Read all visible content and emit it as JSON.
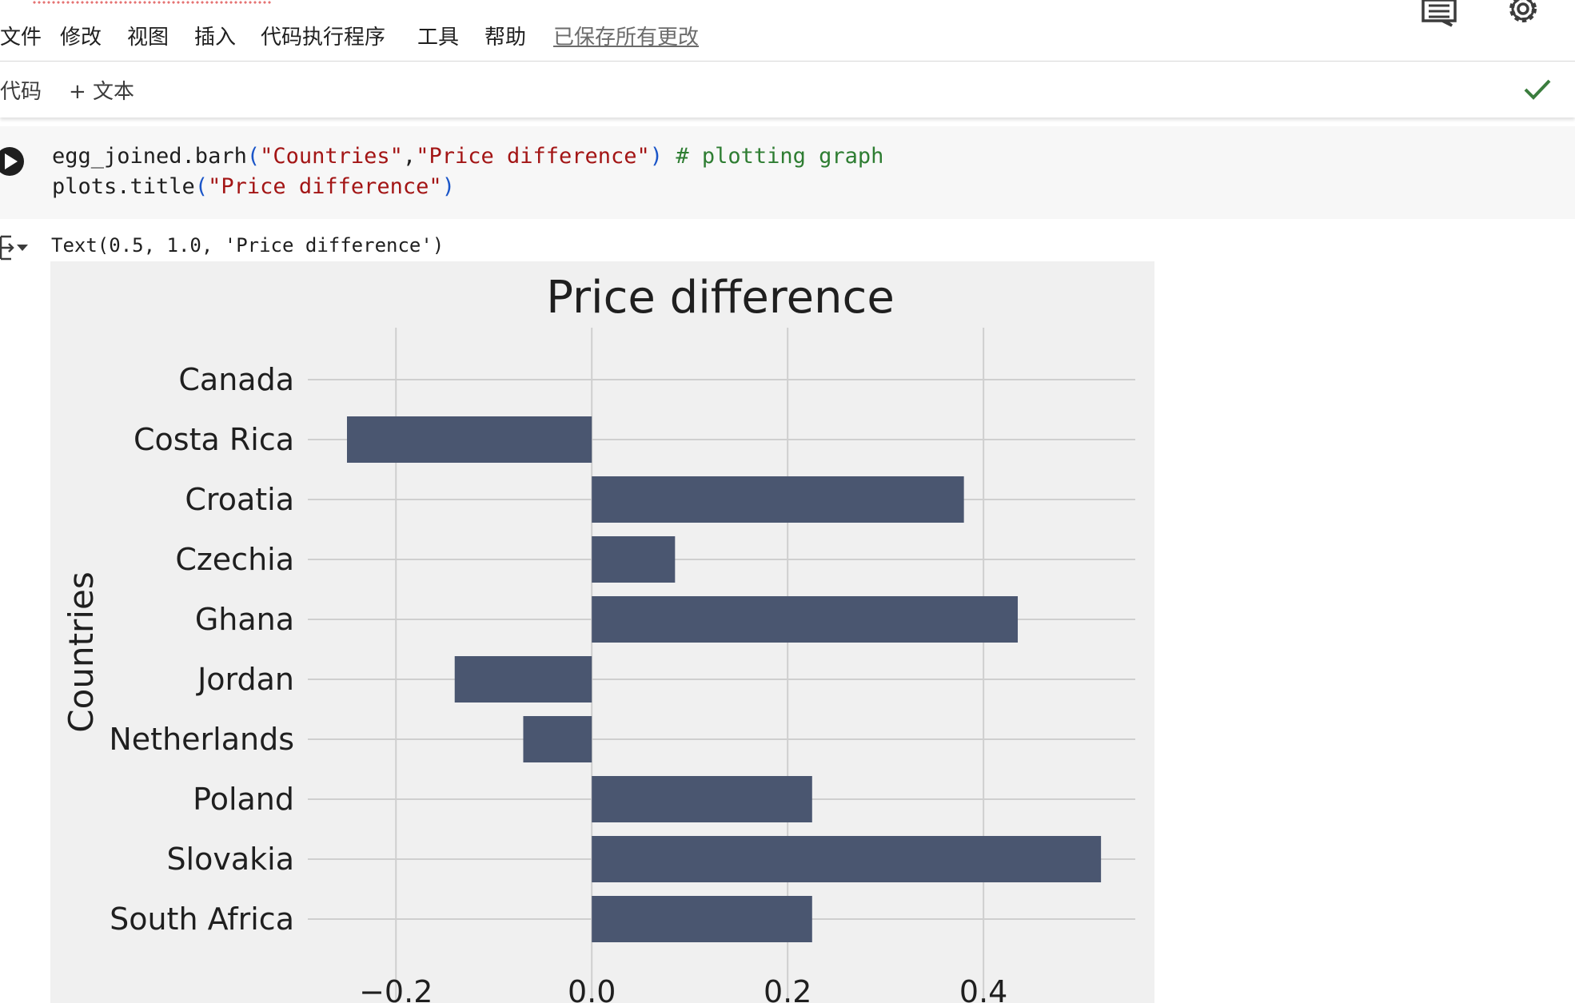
{
  "menu": {
    "items": [
      "文件",
      "修改",
      "视图",
      "插入",
      "代码执行程序",
      "工具",
      "帮助"
    ],
    "saved_status": "已保存所有更改"
  },
  "toolbar": {
    "code_label": "代码",
    "add_text_label": "+ 文本"
  },
  "icons": {
    "comments": "comment-icon",
    "settings": "gear-icon",
    "run": "play-icon",
    "status": "checkmark-icon",
    "output": "output-icon"
  },
  "colors": {
    "bar": "#4a5670",
    "plot_bg": "#f0f0f0",
    "check": "#3b7d3e"
  },
  "code": {
    "line1_obj": "egg_joined.barh",
    "line1_arg1": "\"Countries\"",
    "line1_comma": ",",
    "line1_arg2": "\"Price difference\"",
    "line1_comment": "# plotting graph",
    "line2_obj": "plots.title",
    "line2_arg": "\"Price difference\"",
    "paren_open": "(",
    "paren_close": ")"
  },
  "output": {
    "text": "Text(0.5, 1.0, 'Price difference')"
  },
  "chart_data": {
    "type": "bar",
    "orientation": "horizontal",
    "title": "Price difference",
    "ylabel": "Countries",
    "xlabel": "",
    "categories": [
      "Canada",
      "Costa Rica",
      "Croatia",
      "Czechia",
      "Ghana",
      "Jordan",
      "Netherlands",
      "Poland",
      "Slovakia",
      "South Africa"
    ],
    "values": [
      0.0,
      -0.25,
      0.38,
      0.085,
      0.435,
      -0.14,
      -0.07,
      0.225,
      0.52,
      0.225
    ],
    "xticks": [
      -0.2,
      0.0,
      0.2,
      0.4
    ],
    "xtick_labels": [
      "−0.2",
      "0.0",
      "0.2",
      "0.4"
    ],
    "xlim": [
      -0.29,
      0.555
    ],
    "grid": true
  }
}
